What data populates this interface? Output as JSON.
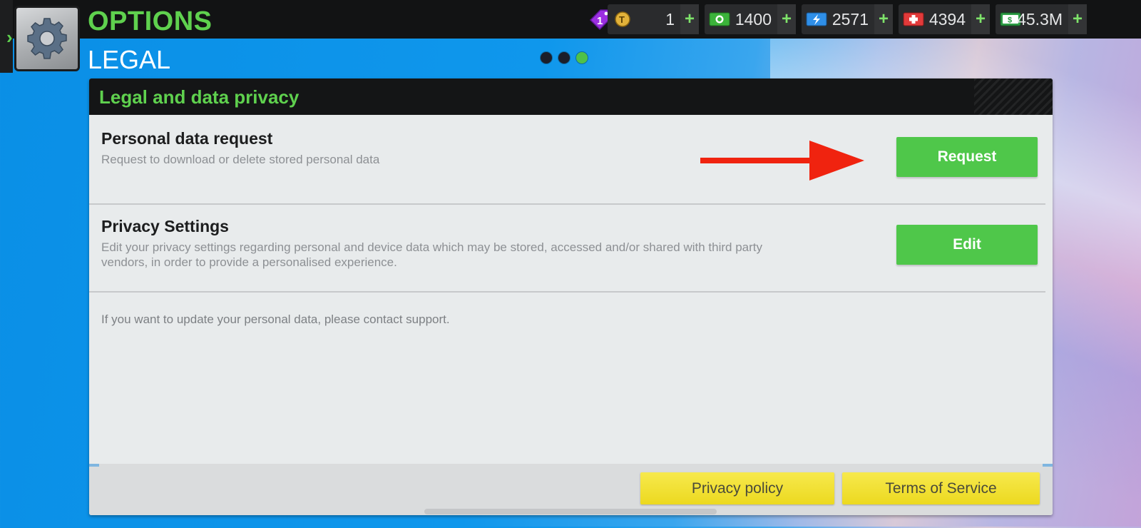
{
  "header": {
    "title": "OPTIONS",
    "subtitle": "LEGAL",
    "page_indicator": {
      "total": 3,
      "active": 3
    }
  },
  "currencies": [
    {
      "icon": "gold-token-icon",
      "value": "1",
      "plus": "+"
    },
    {
      "icon": "cash-icon",
      "value": "1400",
      "plus": "+"
    },
    {
      "icon": "energy-icon",
      "value": "2571",
      "plus": "+"
    },
    {
      "icon": "health-icon",
      "value": "4394",
      "plus": "+"
    },
    {
      "icon": "money-icon",
      "value": "45.3M",
      "plus": "+"
    }
  ],
  "offer_tag": {
    "icon": "offer-tag-icon",
    "count": "1"
  },
  "panel": {
    "title": "Legal and data privacy",
    "personal_data": {
      "title": "Personal data request",
      "description": "Request to download or delete stored personal data",
      "button": "Request"
    },
    "privacy_settings": {
      "title": "Privacy Settings",
      "description": "Edit your privacy settings regarding personal and device data which may be stored, accessed and/or shared with third party vendors, in order to provide a personalised experience.",
      "button": "Edit"
    },
    "note": "If you want to update your personal data, please contact support."
  },
  "footer": {
    "privacy_policy": "Privacy policy",
    "terms": "Terms of Service"
  },
  "colors": {
    "accent_green": "#5fd14e",
    "button_green": "#4fc74a",
    "button_yellow": "#f1df34",
    "annotation_arrow": "#f0230f"
  }
}
